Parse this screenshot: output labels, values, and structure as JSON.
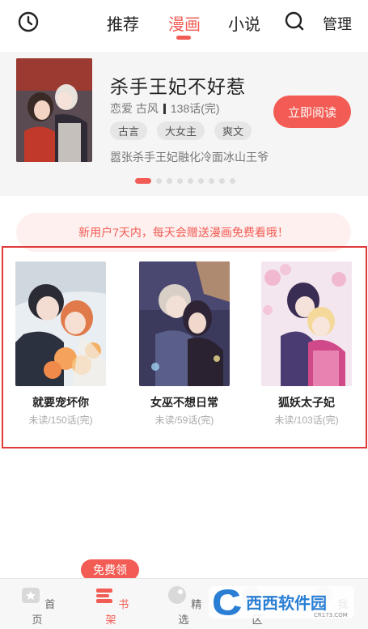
{
  "topnav": {
    "tabs": [
      {
        "label": "推荐"
      },
      {
        "label": "漫画"
      },
      {
        "label": "小说"
      }
    ],
    "active_tab": "漫画",
    "manage_label": "管理",
    "accent": "#f25c54"
  },
  "featured": {
    "title": "杀手王妃不好惹",
    "genres": "恋爱 古风",
    "chapters": "138话(完)",
    "tags": [
      "古言",
      "大女主",
      "爽文"
    ],
    "description": "嚣张杀手王妃融化冷面冰山王爷",
    "read_button": "立即阅读",
    "carousel_count": 9,
    "carousel_active": 0
  },
  "promo": {
    "text": "新用户7天内，每天会赠送漫画免费看哦！"
  },
  "shelf": {
    "books": [
      {
        "title": "就要宠坏你",
        "progress": "未读/150话(完)"
      },
      {
        "title": "女巫不想日常",
        "progress": "未读/59话(完)"
      },
      {
        "title": "狐妖太子妃",
        "progress": "未读/103话(完)"
      }
    ]
  },
  "bottomnav": {
    "items": [
      {
        "label": "首页"
      },
      {
        "label": "书架"
      },
      {
        "label": "精选"
      },
      {
        "label": "社区"
      },
      {
        "label": "我"
      }
    ],
    "active": "书架",
    "free_badge": "免费领"
  },
  "watermark": {
    "text": "西西软件园",
    "domain": "CR173.COM"
  }
}
